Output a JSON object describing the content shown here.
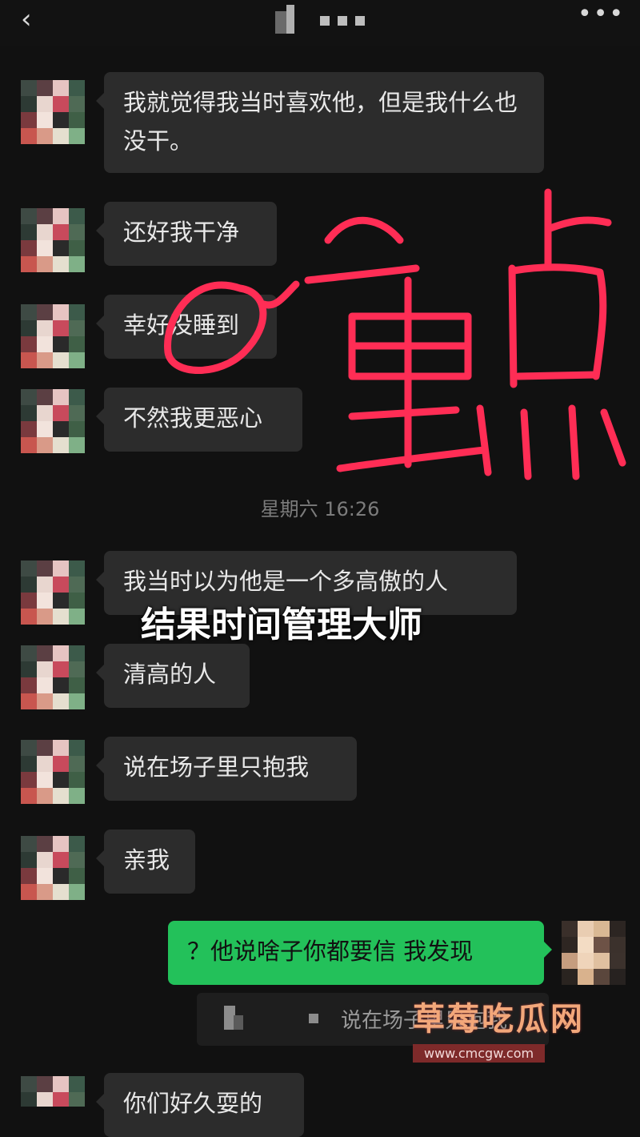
{
  "header": {
    "back_icon": "chevron-left-icon",
    "title_masked": true,
    "more_icon": "ellipsis-icon",
    "more_label": "•••"
  },
  "messages": [
    {
      "from": "other",
      "text": "我就觉得我当时喜欢他，但是我什么也没干。"
    },
    {
      "from": "other",
      "text": "还好我干净"
    },
    {
      "from": "other",
      "text": "幸好没睡到"
    },
    {
      "from": "other",
      "text": "不然我更恶心"
    },
    {
      "type": "timestamp",
      "text": "星期六 16:26"
    },
    {
      "from": "other",
      "text": "我当时以为他是一个多高傲的人"
    },
    {
      "from": "other",
      "text": "清高的人"
    },
    {
      "from": "other",
      "text": "说在场子里只抱我"
    },
    {
      "from": "other",
      "text": "亲我"
    },
    {
      "from": "me",
      "text": "？他说啥子你都要信 我发现"
    },
    {
      "from": "other",
      "text": "你们好久耍的"
    }
  ],
  "quote": {
    "text": "说在场子里只抱我"
  },
  "overlay_caption": "结果时间管理大师",
  "annotation": {
    "text": "重点",
    "color": "#ff2d55"
  },
  "watermark": {
    "title": "草莓吃瓜网",
    "url": "www.cmcgw.com"
  },
  "colors": {
    "background": "#111111",
    "bubble_other": "#2c2c2c",
    "bubble_me": "#23c15a"
  }
}
